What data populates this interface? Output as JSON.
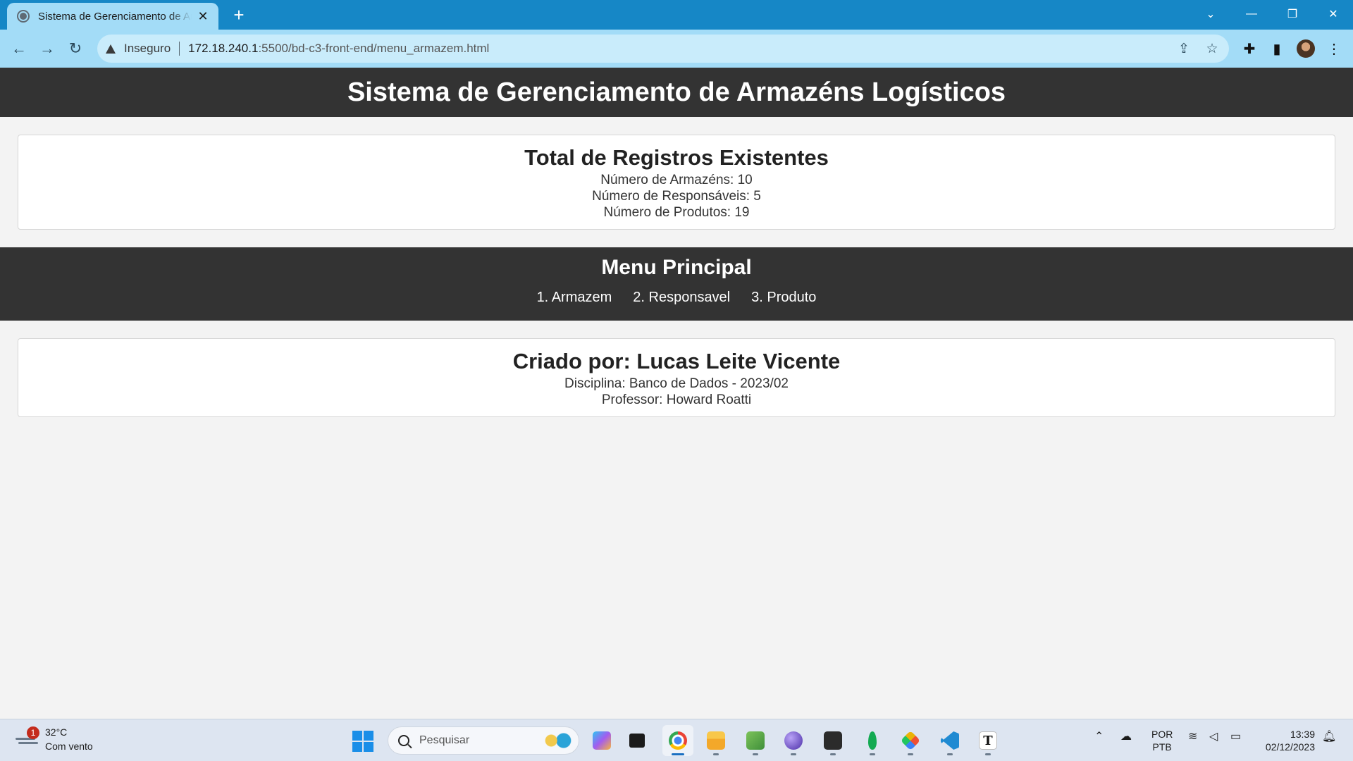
{
  "browser": {
    "tab_title": "Sistema de Gerenciamento de Armazéns Logísticos",
    "new_tab": "+",
    "close": "✕",
    "insecure_label": "Inseguro",
    "url_host": "172.18.240.1",
    "url_rest": ":5500/bd-c3-front-end/menu_armazem.html"
  },
  "page": {
    "title": "Sistema de Gerenciamento de Armazéns Logísticos",
    "stats": {
      "title": "Total de Registros Existentes",
      "armazens": "Número de Armazéns: 10",
      "responsaveis": "Número de Responsáveis: 5",
      "produtos": "Número de Produtos: 19"
    },
    "menu": {
      "title": "Menu Principal",
      "items": [
        "1. Armazem",
        "2. Responsavel",
        "3. Produto"
      ]
    },
    "credits": {
      "title": "Criado por: Lucas Leite Vicente",
      "discipline": "Disciplina: Banco de Dados - 2023/02",
      "professor": "Professor: Howard Roatti"
    }
  },
  "taskbar": {
    "weather_badge": "1",
    "temperature": "32°C",
    "weather_desc": "Com vento",
    "search_placeholder": "Pesquisar",
    "lang_line1": "POR",
    "lang_line2": "PTB",
    "time": "13:39",
    "date": "02/12/2023"
  },
  "icons": {
    "accent": "#1687c6",
    "apps": [
      "copilot-icon",
      "task-view-icon",
      "chrome-icon",
      "file-explorer-icon",
      "notepad-icon",
      "obsidian-icon",
      "terminal-icon",
      "mongodb-icon",
      "git-icon",
      "vscode-icon",
      "typora-icon"
    ]
  }
}
